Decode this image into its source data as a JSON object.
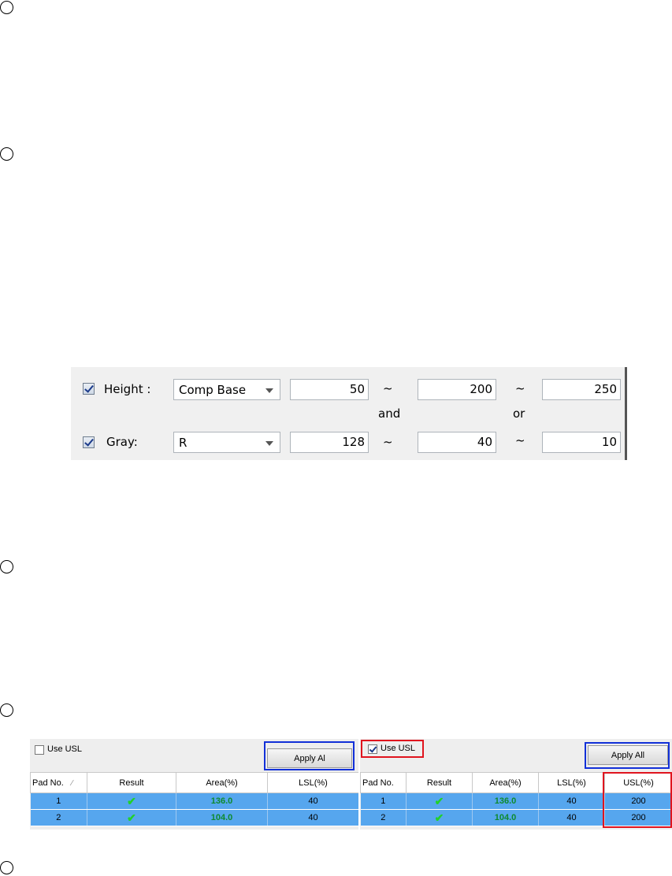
{
  "height_gray_panel": {
    "height_label": "Height :",
    "height_mode": "Comp Base",
    "height_values": [
      "50",
      "200",
      "250"
    ],
    "tilde": "~",
    "and_label": "and",
    "or_label": "or",
    "gray_label": "Gray:",
    "gray_channel": "R",
    "gray_values": [
      "128",
      "40",
      "10"
    ]
  },
  "grid_left": {
    "use_usl_label": "Use USL",
    "use_usl_checked": false,
    "apply_label": "Apply Al",
    "columns": [
      "Pad No.",
      "Result",
      "Area(%)",
      "LSL(%)"
    ],
    "rows": [
      {
        "pad": "1",
        "area": "136.0",
        "lsl": "40"
      },
      {
        "pad": "2",
        "area": "104.0",
        "lsl": "40"
      }
    ]
  },
  "grid_right": {
    "use_usl_label": "Use USL",
    "use_usl_checked": true,
    "apply_label": "Apply All",
    "columns": [
      "Pad No.",
      "Result",
      "Area(%)",
      "LSL(%)",
      "USL(%)"
    ],
    "rows": [
      {
        "pad": "1",
        "area": "136.0",
        "lsl": "40",
        "usl": "200"
      },
      {
        "pad": "2",
        "area": "104.0",
        "lsl": "40",
        "usl": "200"
      }
    ]
  },
  "colors": {
    "row_selected": "#56a6ee",
    "area_text": "#0e8a2e",
    "highlight_blue": "#1230d8",
    "highlight_red": "#e0141e"
  }
}
